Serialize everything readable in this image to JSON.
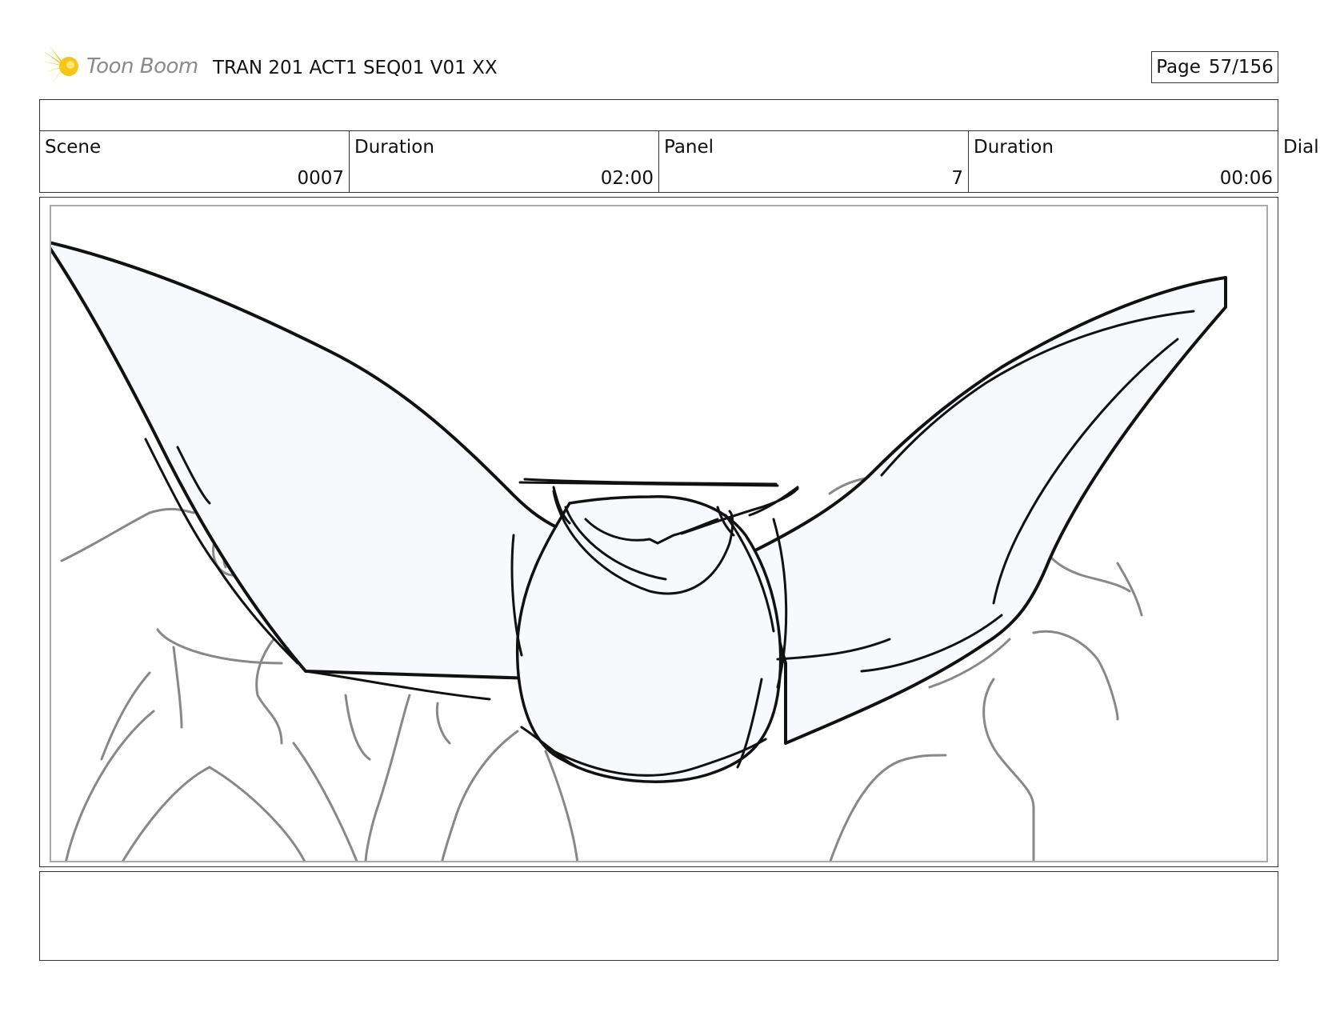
{
  "header": {
    "logo_text": "Toon Boom",
    "doc_title": "TRAN 201 ACT1 SEQ01 V01 XX",
    "page_label": "Page",
    "page_value": "57/156"
  },
  "info": {
    "scene_label": "Scene",
    "scene_value": "0007",
    "duration_label": "Duration",
    "duration_value": "02:00",
    "panel_label": "Panel",
    "panel_value": "7",
    "panel_duration_label": "Duration",
    "panel_duration_value": "00:06",
    "dialog_label": "Dialo"
  },
  "colors": {
    "logo_star": "#f5c518",
    "wing_fill": "#f7f9fd",
    "sketch_dark": "#111111",
    "sketch_gray": "#888888"
  },
  "icons": {
    "logo": "toon-boom-star-icon"
  }
}
